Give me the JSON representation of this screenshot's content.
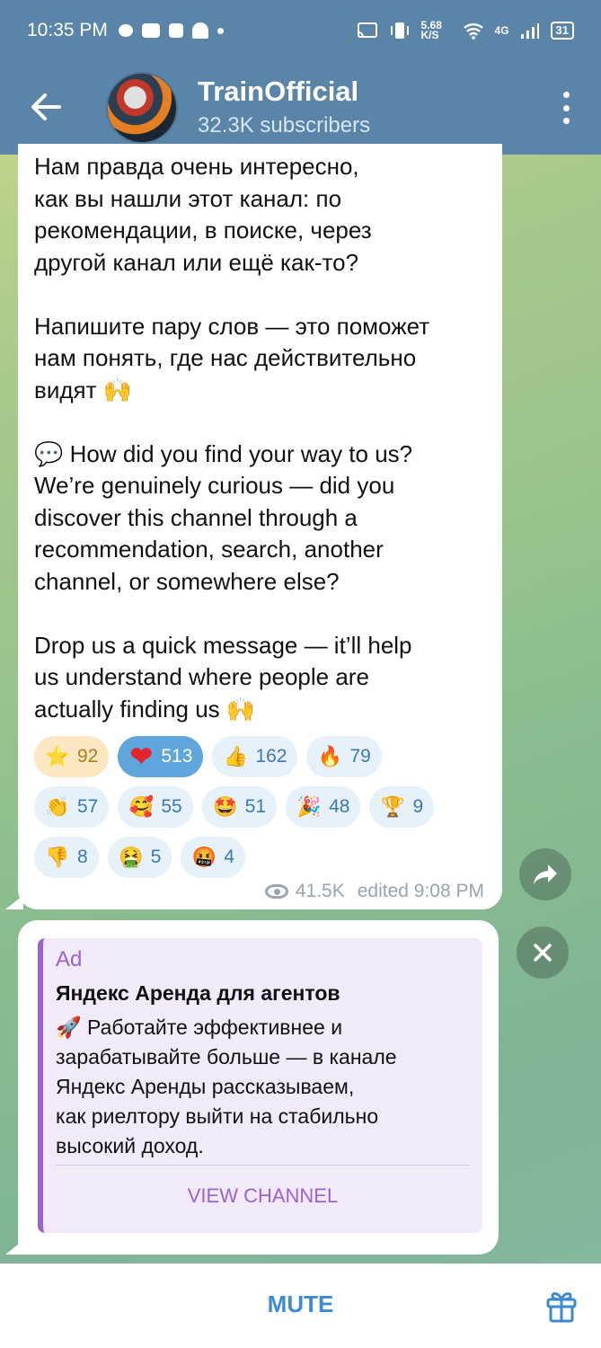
{
  "status_bar": {
    "time": "10:35 PM",
    "speed": "5.68 K/S",
    "network": "4G",
    "battery": "31"
  },
  "header": {
    "title": "TrainOfficial",
    "subtitle": "32.3K subscribers",
    "back_icon": "arrow-left-icon",
    "menu_icon": "more-vertical-icon"
  },
  "message": {
    "text": "Нам правда очень интересно,\nкак вы нашли этот канал: по\nрекомендации, в поиске, через\nдругой канал или ещё как-то?\n\nНапишите пару слов — это поможет\nнам понять, где нас действительно\nвидят 🙌\n\n💬 How did you find your way to us?\nWe’re genuinely curious — did you\ndiscover this channel through a\nrecommendation, search, another\nchannel, or somewhere else?\n\nDrop us a quick message — it’ll help\nus understand where people are\nactually finding us 🙌",
    "reactions": [
      {
        "emoji": "⭐",
        "count": "92"
      },
      {
        "emoji": "❤",
        "count": "513"
      },
      {
        "emoji": "👍",
        "count": "162"
      },
      {
        "emoji": "🔥",
        "count": "79"
      },
      {
        "emoji": "👏",
        "count": "57"
      },
      {
        "emoji": "🥰",
        "count": "55"
      },
      {
        "emoji": "🤩",
        "count": "51"
      },
      {
        "emoji": "🎉",
        "count": "48"
      },
      {
        "emoji": "🏆",
        "count": "9"
      },
      {
        "emoji": "👎",
        "count": "8"
      },
      {
        "emoji": "🤮",
        "count": "5"
      },
      {
        "emoji": "🤬",
        "count": "4"
      }
    ],
    "views": "41.5K",
    "edited": "edited 9:08 PM"
  },
  "ad": {
    "label": "Ad",
    "title": "Яндекс Аренда для агентов",
    "body": "🚀 Работайте эффективнее и\nзарабатывайте больше — в канале\nЯндекс Аренды рассказываем,\nкак риелтору выйти на стабильно\nвысокий доход.",
    "cta": "VIEW CHANNEL"
  },
  "bottom": {
    "mute": "MUTE"
  },
  "colors": {
    "header": "#5a85a9",
    "accent": "#3d8ad4",
    "ad_accent": "#9b63d1"
  }
}
